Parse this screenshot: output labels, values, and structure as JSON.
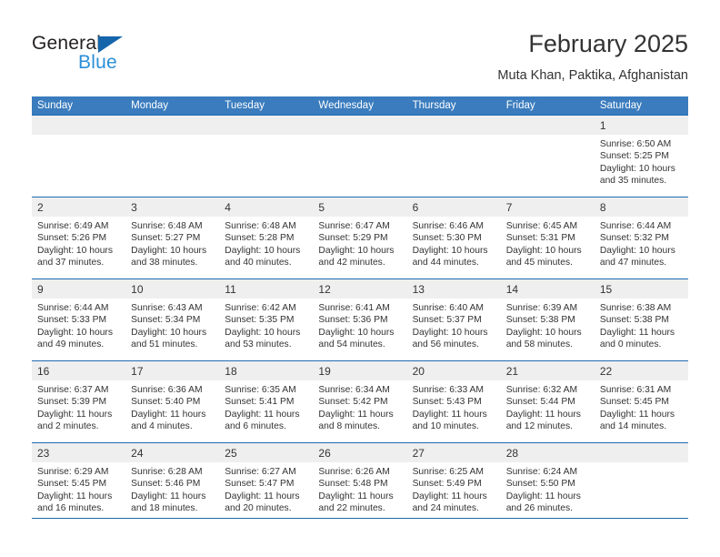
{
  "brand": {
    "name_primary": "General",
    "name_secondary": "Blue",
    "primary_color": "#231f20",
    "secondary_color": "#2b8fd8",
    "triangle_color": "#1565ab"
  },
  "header": {
    "month_title": "February 2025",
    "location": "Muta Khan, Paktika, Afghanistan"
  },
  "theme": {
    "header_row_bg": "#3a7cbe",
    "header_row_text": "#ffffff",
    "daynum_bg": "#efefef",
    "rule_color": "#1f6bb0",
    "body_text": "#333333"
  },
  "calendar": {
    "weekday_headers": [
      "Sunday",
      "Monday",
      "Tuesday",
      "Wednesday",
      "Thursday",
      "Friday",
      "Saturday"
    ],
    "weeks": [
      [
        {
          "day": "",
          "sunrise": "",
          "sunset": "",
          "daylight_line1": "",
          "daylight_line2": "",
          "empty": true
        },
        {
          "day": "",
          "sunrise": "",
          "sunset": "",
          "daylight_line1": "",
          "daylight_line2": "",
          "empty": true
        },
        {
          "day": "",
          "sunrise": "",
          "sunset": "",
          "daylight_line1": "",
          "daylight_line2": "",
          "empty": true
        },
        {
          "day": "",
          "sunrise": "",
          "sunset": "",
          "daylight_line1": "",
          "daylight_line2": "",
          "empty": true
        },
        {
          "day": "",
          "sunrise": "",
          "sunset": "",
          "daylight_line1": "",
          "daylight_line2": "",
          "empty": true
        },
        {
          "day": "",
          "sunrise": "",
          "sunset": "",
          "daylight_line1": "",
          "daylight_line2": "",
          "empty": true
        },
        {
          "day": "1",
          "sunrise": "Sunrise: 6:50 AM",
          "sunset": "Sunset: 5:25 PM",
          "daylight_line1": "Daylight: 10 hours",
          "daylight_line2": "and 35 minutes.",
          "empty": false
        }
      ],
      [
        {
          "day": "2",
          "sunrise": "Sunrise: 6:49 AM",
          "sunset": "Sunset: 5:26 PM",
          "daylight_line1": "Daylight: 10 hours",
          "daylight_line2": "and 37 minutes.",
          "empty": false
        },
        {
          "day": "3",
          "sunrise": "Sunrise: 6:48 AM",
          "sunset": "Sunset: 5:27 PM",
          "daylight_line1": "Daylight: 10 hours",
          "daylight_line2": "and 38 minutes.",
          "empty": false
        },
        {
          "day": "4",
          "sunrise": "Sunrise: 6:48 AM",
          "sunset": "Sunset: 5:28 PM",
          "daylight_line1": "Daylight: 10 hours",
          "daylight_line2": "and 40 minutes.",
          "empty": false
        },
        {
          "day": "5",
          "sunrise": "Sunrise: 6:47 AM",
          "sunset": "Sunset: 5:29 PM",
          "daylight_line1": "Daylight: 10 hours",
          "daylight_line2": "and 42 minutes.",
          "empty": false
        },
        {
          "day": "6",
          "sunrise": "Sunrise: 6:46 AM",
          "sunset": "Sunset: 5:30 PM",
          "daylight_line1": "Daylight: 10 hours",
          "daylight_line2": "and 44 minutes.",
          "empty": false
        },
        {
          "day": "7",
          "sunrise": "Sunrise: 6:45 AM",
          "sunset": "Sunset: 5:31 PM",
          "daylight_line1": "Daylight: 10 hours",
          "daylight_line2": "and 45 minutes.",
          "empty": false
        },
        {
          "day": "8",
          "sunrise": "Sunrise: 6:44 AM",
          "sunset": "Sunset: 5:32 PM",
          "daylight_line1": "Daylight: 10 hours",
          "daylight_line2": "and 47 minutes.",
          "empty": false
        }
      ],
      [
        {
          "day": "9",
          "sunrise": "Sunrise: 6:44 AM",
          "sunset": "Sunset: 5:33 PM",
          "daylight_line1": "Daylight: 10 hours",
          "daylight_line2": "and 49 minutes.",
          "empty": false
        },
        {
          "day": "10",
          "sunrise": "Sunrise: 6:43 AM",
          "sunset": "Sunset: 5:34 PM",
          "daylight_line1": "Daylight: 10 hours",
          "daylight_line2": "and 51 minutes.",
          "empty": false
        },
        {
          "day": "11",
          "sunrise": "Sunrise: 6:42 AM",
          "sunset": "Sunset: 5:35 PM",
          "daylight_line1": "Daylight: 10 hours",
          "daylight_line2": "and 53 minutes.",
          "empty": false
        },
        {
          "day": "12",
          "sunrise": "Sunrise: 6:41 AM",
          "sunset": "Sunset: 5:36 PM",
          "daylight_line1": "Daylight: 10 hours",
          "daylight_line2": "and 54 minutes.",
          "empty": false
        },
        {
          "day": "13",
          "sunrise": "Sunrise: 6:40 AM",
          "sunset": "Sunset: 5:37 PM",
          "daylight_line1": "Daylight: 10 hours",
          "daylight_line2": "and 56 minutes.",
          "empty": false
        },
        {
          "day": "14",
          "sunrise": "Sunrise: 6:39 AM",
          "sunset": "Sunset: 5:38 PM",
          "daylight_line1": "Daylight: 10 hours",
          "daylight_line2": "and 58 minutes.",
          "empty": false
        },
        {
          "day": "15",
          "sunrise": "Sunrise: 6:38 AM",
          "sunset": "Sunset: 5:38 PM",
          "daylight_line1": "Daylight: 11 hours",
          "daylight_line2": "and 0 minutes.",
          "empty": false
        }
      ],
      [
        {
          "day": "16",
          "sunrise": "Sunrise: 6:37 AM",
          "sunset": "Sunset: 5:39 PM",
          "daylight_line1": "Daylight: 11 hours",
          "daylight_line2": "and 2 minutes.",
          "empty": false
        },
        {
          "day": "17",
          "sunrise": "Sunrise: 6:36 AM",
          "sunset": "Sunset: 5:40 PM",
          "daylight_line1": "Daylight: 11 hours",
          "daylight_line2": "and 4 minutes.",
          "empty": false
        },
        {
          "day": "18",
          "sunrise": "Sunrise: 6:35 AM",
          "sunset": "Sunset: 5:41 PM",
          "daylight_line1": "Daylight: 11 hours",
          "daylight_line2": "and 6 minutes.",
          "empty": false
        },
        {
          "day": "19",
          "sunrise": "Sunrise: 6:34 AM",
          "sunset": "Sunset: 5:42 PM",
          "daylight_line1": "Daylight: 11 hours",
          "daylight_line2": "and 8 minutes.",
          "empty": false
        },
        {
          "day": "20",
          "sunrise": "Sunrise: 6:33 AM",
          "sunset": "Sunset: 5:43 PM",
          "daylight_line1": "Daylight: 11 hours",
          "daylight_line2": "and 10 minutes.",
          "empty": false
        },
        {
          "day": "21",
          "sunrise": "Sunrise: 6:32 AM",
          "sunset": "Sunset: 5:44 PM",
          "daylight_line1": "Daylight: 11 hours",
          "daylight_line2": "and 12 minutes.",
          "empty": false
        },
        {
          "day": "22",
          "sunrise": "Sunrise: 6:31 AM",
          "sunset": "Sunset: 5:45 PM",
          "daylight_line1": "Daylight: 11 hours",
          "daylight_line2": "and 14 minutes.",
          "empty": false
        }
      ],
      [
        {
          "day": "23",
          "sunrise": "Sunrise: 6:29 AM",
          "sunset": "Sunset: 5:45 PM",
          "daylight_line1": "Daylight: 11 hours",
          "daylight_line2": "and 16 minutes.",
          "empty": false
        },
        {
          "day": "24",
          "sunrise": "Sunrise: 6:28 AM",
          "sunset": "Sunset: 5:46 PM",
          "daylight_line1": "Daylight: 11 hours",
          "daylight_line2": "and 18 minutes.",
          "empty": false
        },
        {
          "day": "25",
          "sunrise": "Sunrise: 6:27 AM",
          "sunset": "Sunset: 5:47 PM",
          "daylight_line1": "Daylight: 11 hours",
          "daylight_line2": "and 20 minutes.",
          "empty": false
        },
        {
          "day": "26",
          "sunrise": "Sunrise: 6:26 AM",
          "sunset": "Sunset: 5:48 PM",
          "daylight_line1": "Daylight: 11 hours",
          "daylight_line2": "and 22 minutes.",
          "empty": false
        },
        {
          "day": "27",
          "sunrise": "Sunrise: 6:25 AM",
          "sunset": "Sunset: 5:49 PM",
          "daylight_line1": "Daylight: 11 hours",
          "daylight_line2": "and 24 minutes.",
          "empty": false
        },
        {
          "day": "28",
          "sunrise": "Sunrise: 6:24 AM",
          "sunset": "Sunset: 5:50 PM",
          "daylight_line1": "Daylight: 11 hours",
          "daylight_line2": "and 26 minutes.",
          "empty": false
        },
        {
          "day": "",
          "sunrise": "",
          "sunset": "",
          "daylight_line1": "",
          "daylight_line2": "",
          "empty": true
        }
      ]
    ]
  }
}
